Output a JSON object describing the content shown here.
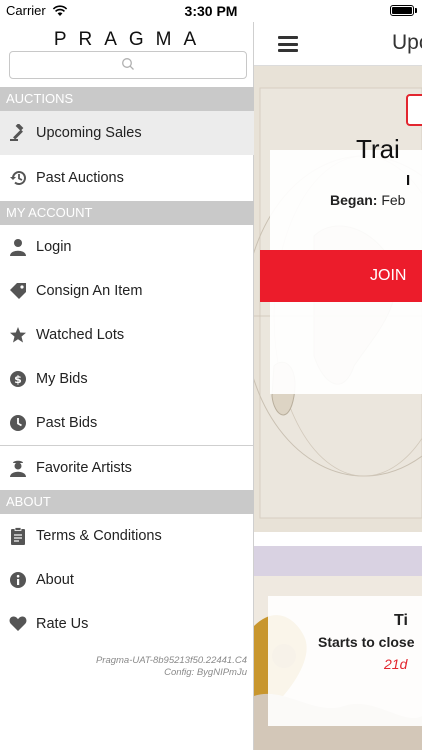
{
  "status_bar": {
    "carrier": "Carrier",
    "time": "3:30 PM"
  },
  "drawer": {
    "logo": "PRAGMA",
    "search": {
      "placeholder": ""
    },
    "sections": {
      "auctions": "AUCTIONS",
      "my_account": "MY ACCOUNT",
      "about": "ABOUT"
    },
    "items": {
      "upcoming_sales": {
        "label": "Upcoming Sales",
        "icon": "gavel-icon"
      },
      "past_auctions": {
        "label": "Past Auctions",
        "icon": "history-icon"
      },
      "login": {
        "label": "Login",
        "icon": "user-icon"
      },
      "consign": {
        "label": "Consign An Item",
        "icon": "tag-icon"
      },
      "watched_lots": {
        "label": "Watched Lots",
        "icon": "star-icon"
      },
      "my_bids": {
        "label": "My Bids",
        "icon": "dollar-icon"
      },
      "past_bids": {
        "label": "Past Bids",
        "icon": "clock-icon"
      },
      "favorite_artists": {
        "label": "Favorite Artists",
        "icon": "artist-icon"
      },
      "terms": {
        "label": "Terms & Conditions",
        "icon": "clipboard-icon"
      },
      "about": {
        "label": "About",
        "icon": "info-icon"
      },
      "rate_us": {
        "label": "Rate Us",
        "icon": "heart-icon"
      }
    },
    "version": {
      "build": "Pragma-UAT-8b95213f50.22441.C4",
      "config": "Config: BygNIPmJu"
    }
  },
  "main": {
    "title": "Upc",
    "card1": {
      "title": "Trai",
      "sub": "I",
      "began_label": "Began:",
      "began_value": "Feb",
      "join_label": "JOIN"
    },
    "card2": {
      "title": "Ti",
      "starts_text": "Starts to close",
      "countdown": "21d"
    }
  },
  "colors": {
    "accent": "#ec1c2b",
    "section_bg": "#c9c9c9"
  }
}
